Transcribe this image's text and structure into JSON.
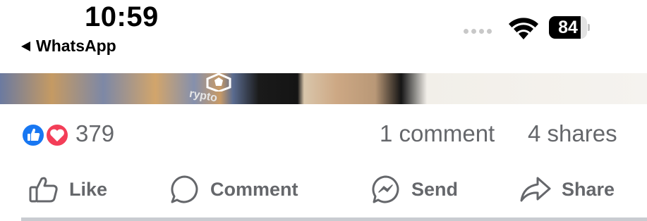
{
  "status_bar": {
    "time": "10:59",
    "back_app": "WhatsApp",
    "battery_level": "84"
  },
  "post_image": {
    "shirt_text": "rypto"
  },
  "reactions": {
    "count": "379",
    "comments": "1 comment",
    "shares": "4 shares",
    "icons": [
      "like-icon",
      "love-icon"
    ],
    "like_color": "#1877f2",
    "love_color": "#f33e58"
  },
  "actions": {
    "like": "Like",
    "comment": "Comment",
    "send": "Send",
    "share": "Share"
  }
}
